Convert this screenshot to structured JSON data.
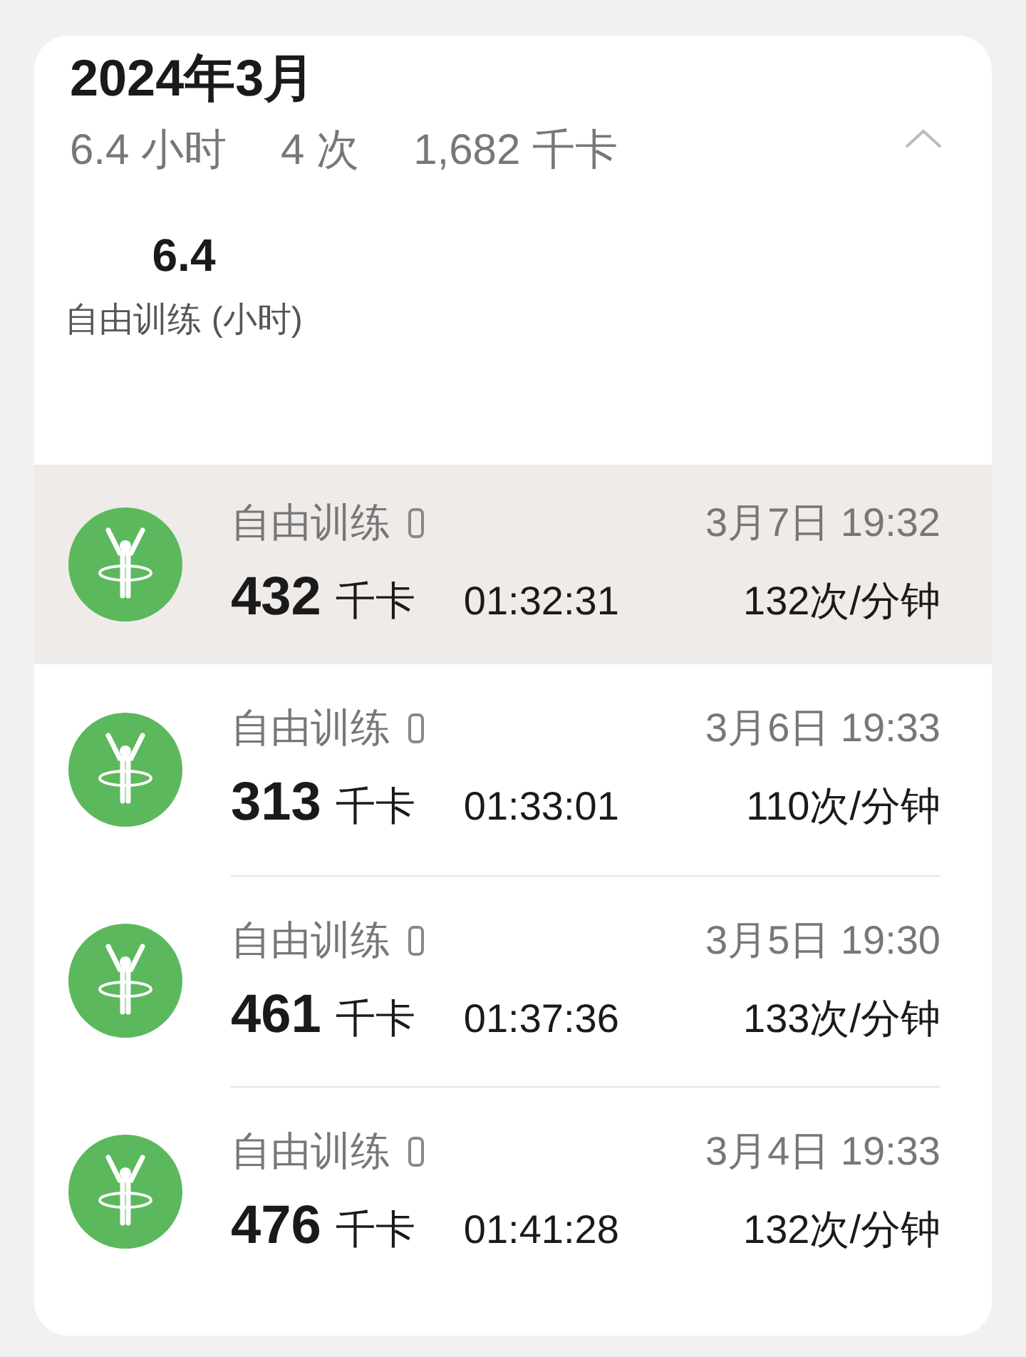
{
  "header": {
    "title": "2024年3月",
    "summary": [
      "6.4 小时",
      "4 次",
      "1,682 千卡"
    ],
    "expanded": true
  },
  "stat": {
    "value": "6.4",
    "label": "自由训练 (小时)"
  },
  "records": [
    {
      "name": "自由训练",
      "time": "3月7日 19:32",
      "calories": "432",
      "unit": "千卡",
      "duration": "01:32:31",
      "heart_rate": "132次/分钟",
      "selected": true
    },
    {
      "name": "自由训练",
      "time": "3月6日 19:33",
      "calories": "313",
      "unit": "千卡",
      "duration": "01:33:01",
      "heart_rate": "110次/分钟",
      "selected": false
    },
    {
      "name": "自由训练",
      "time": "3月5日 19:30",
      "calories": "461",
      "unit": "千卡",
      "duration": "01:37:36",
      "heart_rate": "133次/分钟",
      "selected": false
    },
    {
      "name": "自由训练",
      "time": "3月4日 19:33",
      "calories": "476",
      "unit": "千卡",
      "duration": "01:41:28",
      "heart_rate": "132次/分钟",
      "selected": false
    }
  ]
}
